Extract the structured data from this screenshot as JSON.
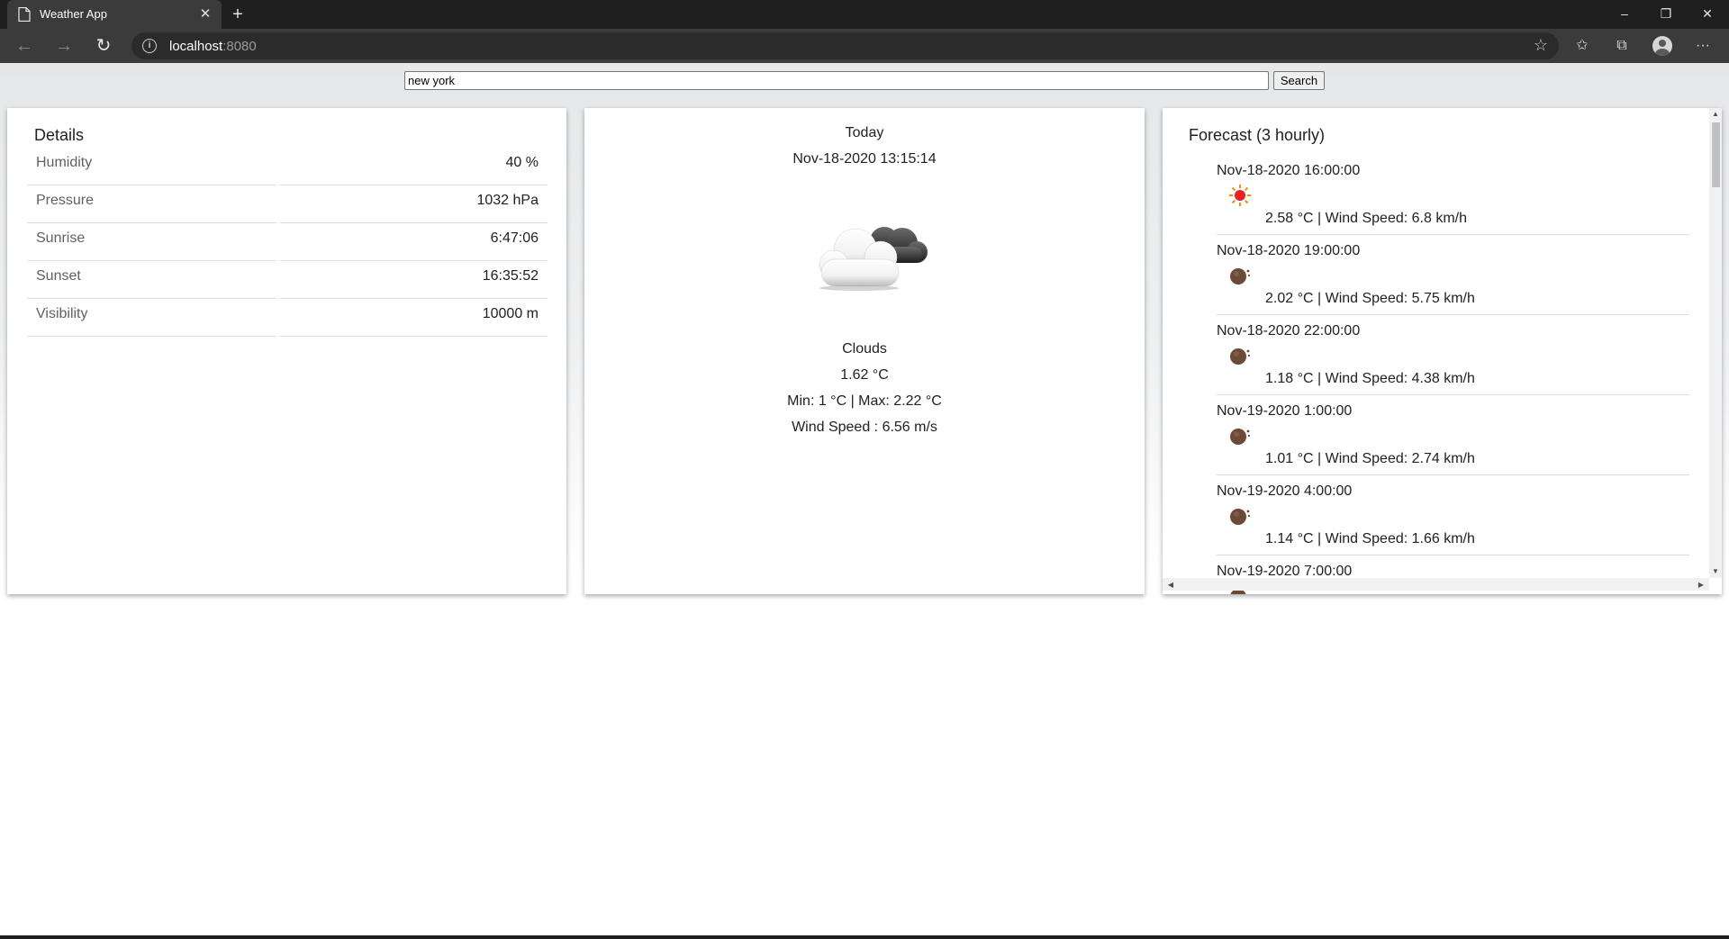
{
  "browser": {
    "tab_title": "Weather App",
    "address_host": "localhost",
    "address_port": ":8080"
  },
  "search": {
    "value": "new york",
    "button_label": "Search"
  },
  "details": {
    "title": "Details",
    "rows": [
      {
        "label": "Humidity",
        "value": "40 %"
      },
      {
        "label": "Pressure",
        "value": "1032 hPa"
      },
      {
        "label": "Sunrise",
        "value": "6:47:06"
      },
      {
        "label": "Sunset",
        "value": "16:35:52"
      },
      {
        "label": "Visibility",
        "value": "10000 m"
      }
    ]
  },
  "today": {
    "heading": "Today",
    "datetime": "Nov-18-2020 13:15:14",
    "icon": "cloud-icon",
    "condition": "Clouds",
    "temp": "1.62 °C",
    "min_max": "Min: 1 °C | Max: 2.22 °C",
    "wind": "Wind Speed : 6.56 m/s"
  },
  "forecast": {
    "title": "Forecast (3 hourly)",
    "items": [
      {
        "time": "Nov-18-2020 16:00:00",
        "icon": "sun-icon",
        "desc": "2.58 °C | Wind Speed: 6.8 km/h"
      },
      {
        "time": "Nov-18-2020 19:00:00",
        "icon": "moon-icon",
        "desc": "2.02 °C | Wind Speed: 5.75 km/h"
      },
      {
        "time": "Nov-18-2020 22:00:00",
        "icon": "moon-icon",
        "desc": "1.18 °C | Wind Speed: 4.38 km/h"
      },
      {
        "time": "Nov-19-2020 1:00:00",
        "icon": "moon-icon",
        "desc": "1.01 °C | Wind Speed: 2.74 km/h"
      },
      {
        "time": "Nov-19-2020 4:00:00",
        "icon": "moon-icon",
        "desc": "1.14 °C | Wind Speed: 1.66 km/h"
      },
      {
        "time": "Nov-19-2020 7:00:00",
        "icon": "moon-icon",
        "desc": ""
      }
    ]
  }
}
